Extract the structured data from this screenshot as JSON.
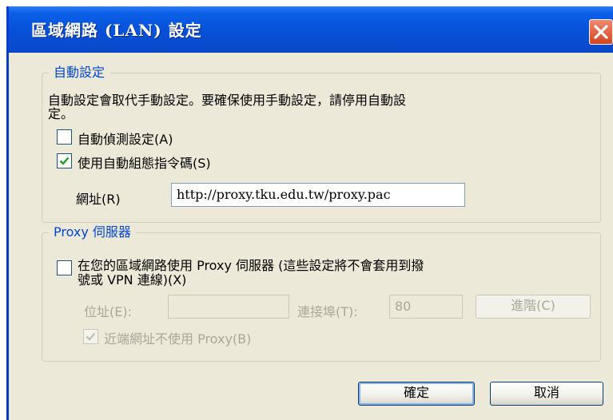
{
  "window": {
    "title": "區域網路 (LAN) 設定",
    "close_icon": "close-icon"
  },
  "auto_config": {
    "legend": "自動設定",
    "description_line1": "自動設定會取代手動設定。要確保使用手動設定，請停用自動設",
    "description_line2": "定。",
    "auto_detect": {
      "label": "自動偵測設定(A)",
      "checked": false
    },
    "use_script": {
      "label": "使用自動組態指令碼(S)",
      "checked": true
    },
    "address_label": "網址(R)",
    "address_value": "http://proxy.tku.edu.tw/proxy.pac"
  },
  "proxy_server": {
    "legend": "Proxy 伺服器",
    "use_proxy": {
      "label_line1": "在您的區域網路使用 Proxy 伺服器 (這些設定將不會套用到撥",
      "label_line2": "號或 VPN 連線)(X)",
      "checked": false
    },
    "address_label": "位址(E):",
    "address_value": "",
    "port_label": "連接埠(T):",
    "port_value": "80",
    "advanced_label": "進階(C)",
    "bypass_local": {
      "label": "近端網址不使用 Proxy(B)",
      "checked": true,
      "enabled": false
    }
  },
  "buttons": {
    "ok_label": "確定",
    "cancel_label": "取消"
  },
  "colors": {
    "title_bar": "#0650d8",
    "dialog_bg": "#ece9d8",
    "legend_text": "#0046d5",
    "disabled_text": "#a8a89a"
  }
}
